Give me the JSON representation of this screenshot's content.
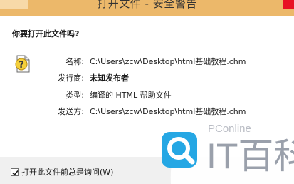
{
  "window": {
    "title": "打开文件 - 安全警告"
  },
  "prompt": {
    "question": "你要打开此文件吗?"
  },
  "file_info": [
    {
      "label": "名称:",
      "value": "C:\\Users\\zcw\\Desktop\\html基础教程.chm",
      "bold": false
    },
    {
      "label": "发行商:",
      "value": "未知发布者",
      "bold": true
    },
    {
      "label": "类型:",
      "value": "编译的 HTML 帮助文件",
      "bold": false
    },
    {
      "label": "发送方:",
      "value": "C:\\Users\\zcw\\Desktop\\html基础教程.chm",
      "bold": false
    }
  ],
  "footer": {
    "checkbox_label": "打开此文件前总是询问(W)",
    "checkbox_checked": true
  },
  "watermark": {
    "site": "PConline",
    "brand": "IT百科"
  },
  "colors": {
    "titlebar": "#ecb86a",
    "content_bg": "#ffffff",
    "footer_bg": "#f0f0f0"
  },
  "icons": {
    "warning": "unknown-file-warning-icon",
    "watermark_logo": "search-magnifier-logo-icon"
  }
}
